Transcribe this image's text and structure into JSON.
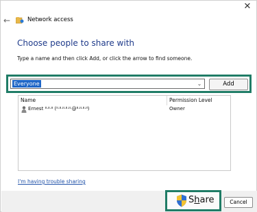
{
  "window": {
    "title": "Network access",
    "close_glyph": "✕",
    "back_glyph": "←"
  },
  "dialog": {
    "heading": "Choose people to share with",
    "instructions": "Type a name and then click Add, or click the arrow to find someone."
  },
  "picker": {
    "value": "Everyone",
    "dropdown_glyph": "⌄",
    "add_label": "Add"
  },
  "list": {
    "columns": [
      "Name",
      "Permission Level"
    ],
    "rows": [
      {
        "icon": "user-icon",
        "name": "Ernest ᐦᐧᐦᐧᐦ (ᐦᐧᐦᐧᐦᐧᐦᐧᐦᐧ@ᐦᐧᐦᐧᐦᐧᐦ)",
        "permission": "Owner"
      }
    ]
  },
  "help_link": "I'm having trouble sharing",
  "footer": {
    "share_label_prefix": "S",
    "share_label_underlined": "h",
    "share_label_suffix": "are",
    "cancel_label": "Cancel"
  },
  "colors": {
    "highlight": "#1f7c66",
    "heading": "#1e3a8a",
    "selection": "#1e66c7",
    "link": "#1e50a8"
  }
}
